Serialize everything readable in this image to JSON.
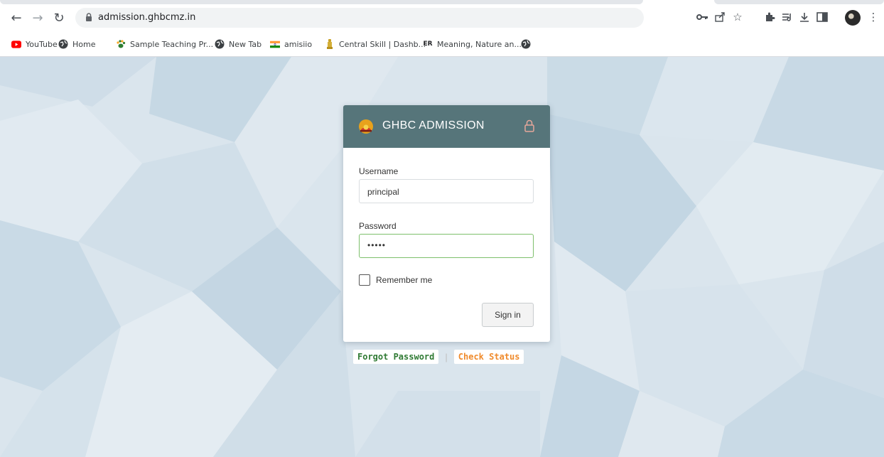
{
  "browser": {
    "url": "admission.ghbcmz.in",
    "bookmarks": [
      {
        "label": "YouTube",
        "icon": "youtube-icon"
      },
      {
        "label": "Home",
        "icon": "globe-icon"
      },
      {
        "label": "Sample Teaching Pr...",
        "icon": "paw-icon"
      },
      {
        "label": "New Tab",
        "icon": "globe-icon"
      },
      {
        "label": "amisiio",
        "icon": "india-flag-icon"
      },
      {
        "label": "Central Skill | Dashb...",
        "icon": "emblem-icon"
      },
      {
        "label": "Meaning, Nature an...",
        "icon": "er-icon",
        "badge": "ER"
      },
      {
        "label": "",
        "icon": "globe-icon"
      }
    ]
  },
  "login": {
    "title": "GHBC ADMISSION",
    "username_label": "Username",
    "username_value": "principal",
    "password_label": "Password",
    "password_mask": "•••••",
    "remember_label": "Remember me",
    "remember_checked": false,
    "signin_label": "Sign in"
  },
  "links": {
    "forgot": "Forgot Password",
    "separator": "|",
    "status": "Check Status"
  },
  "colors": {
    "header": "#56757a",
    "page_bg": "#dbe6ee",
    "forgot": "#2f7a33",
    "status": "#f08a2b",
    "focus_border": "#7dbf6b"
  }
}
